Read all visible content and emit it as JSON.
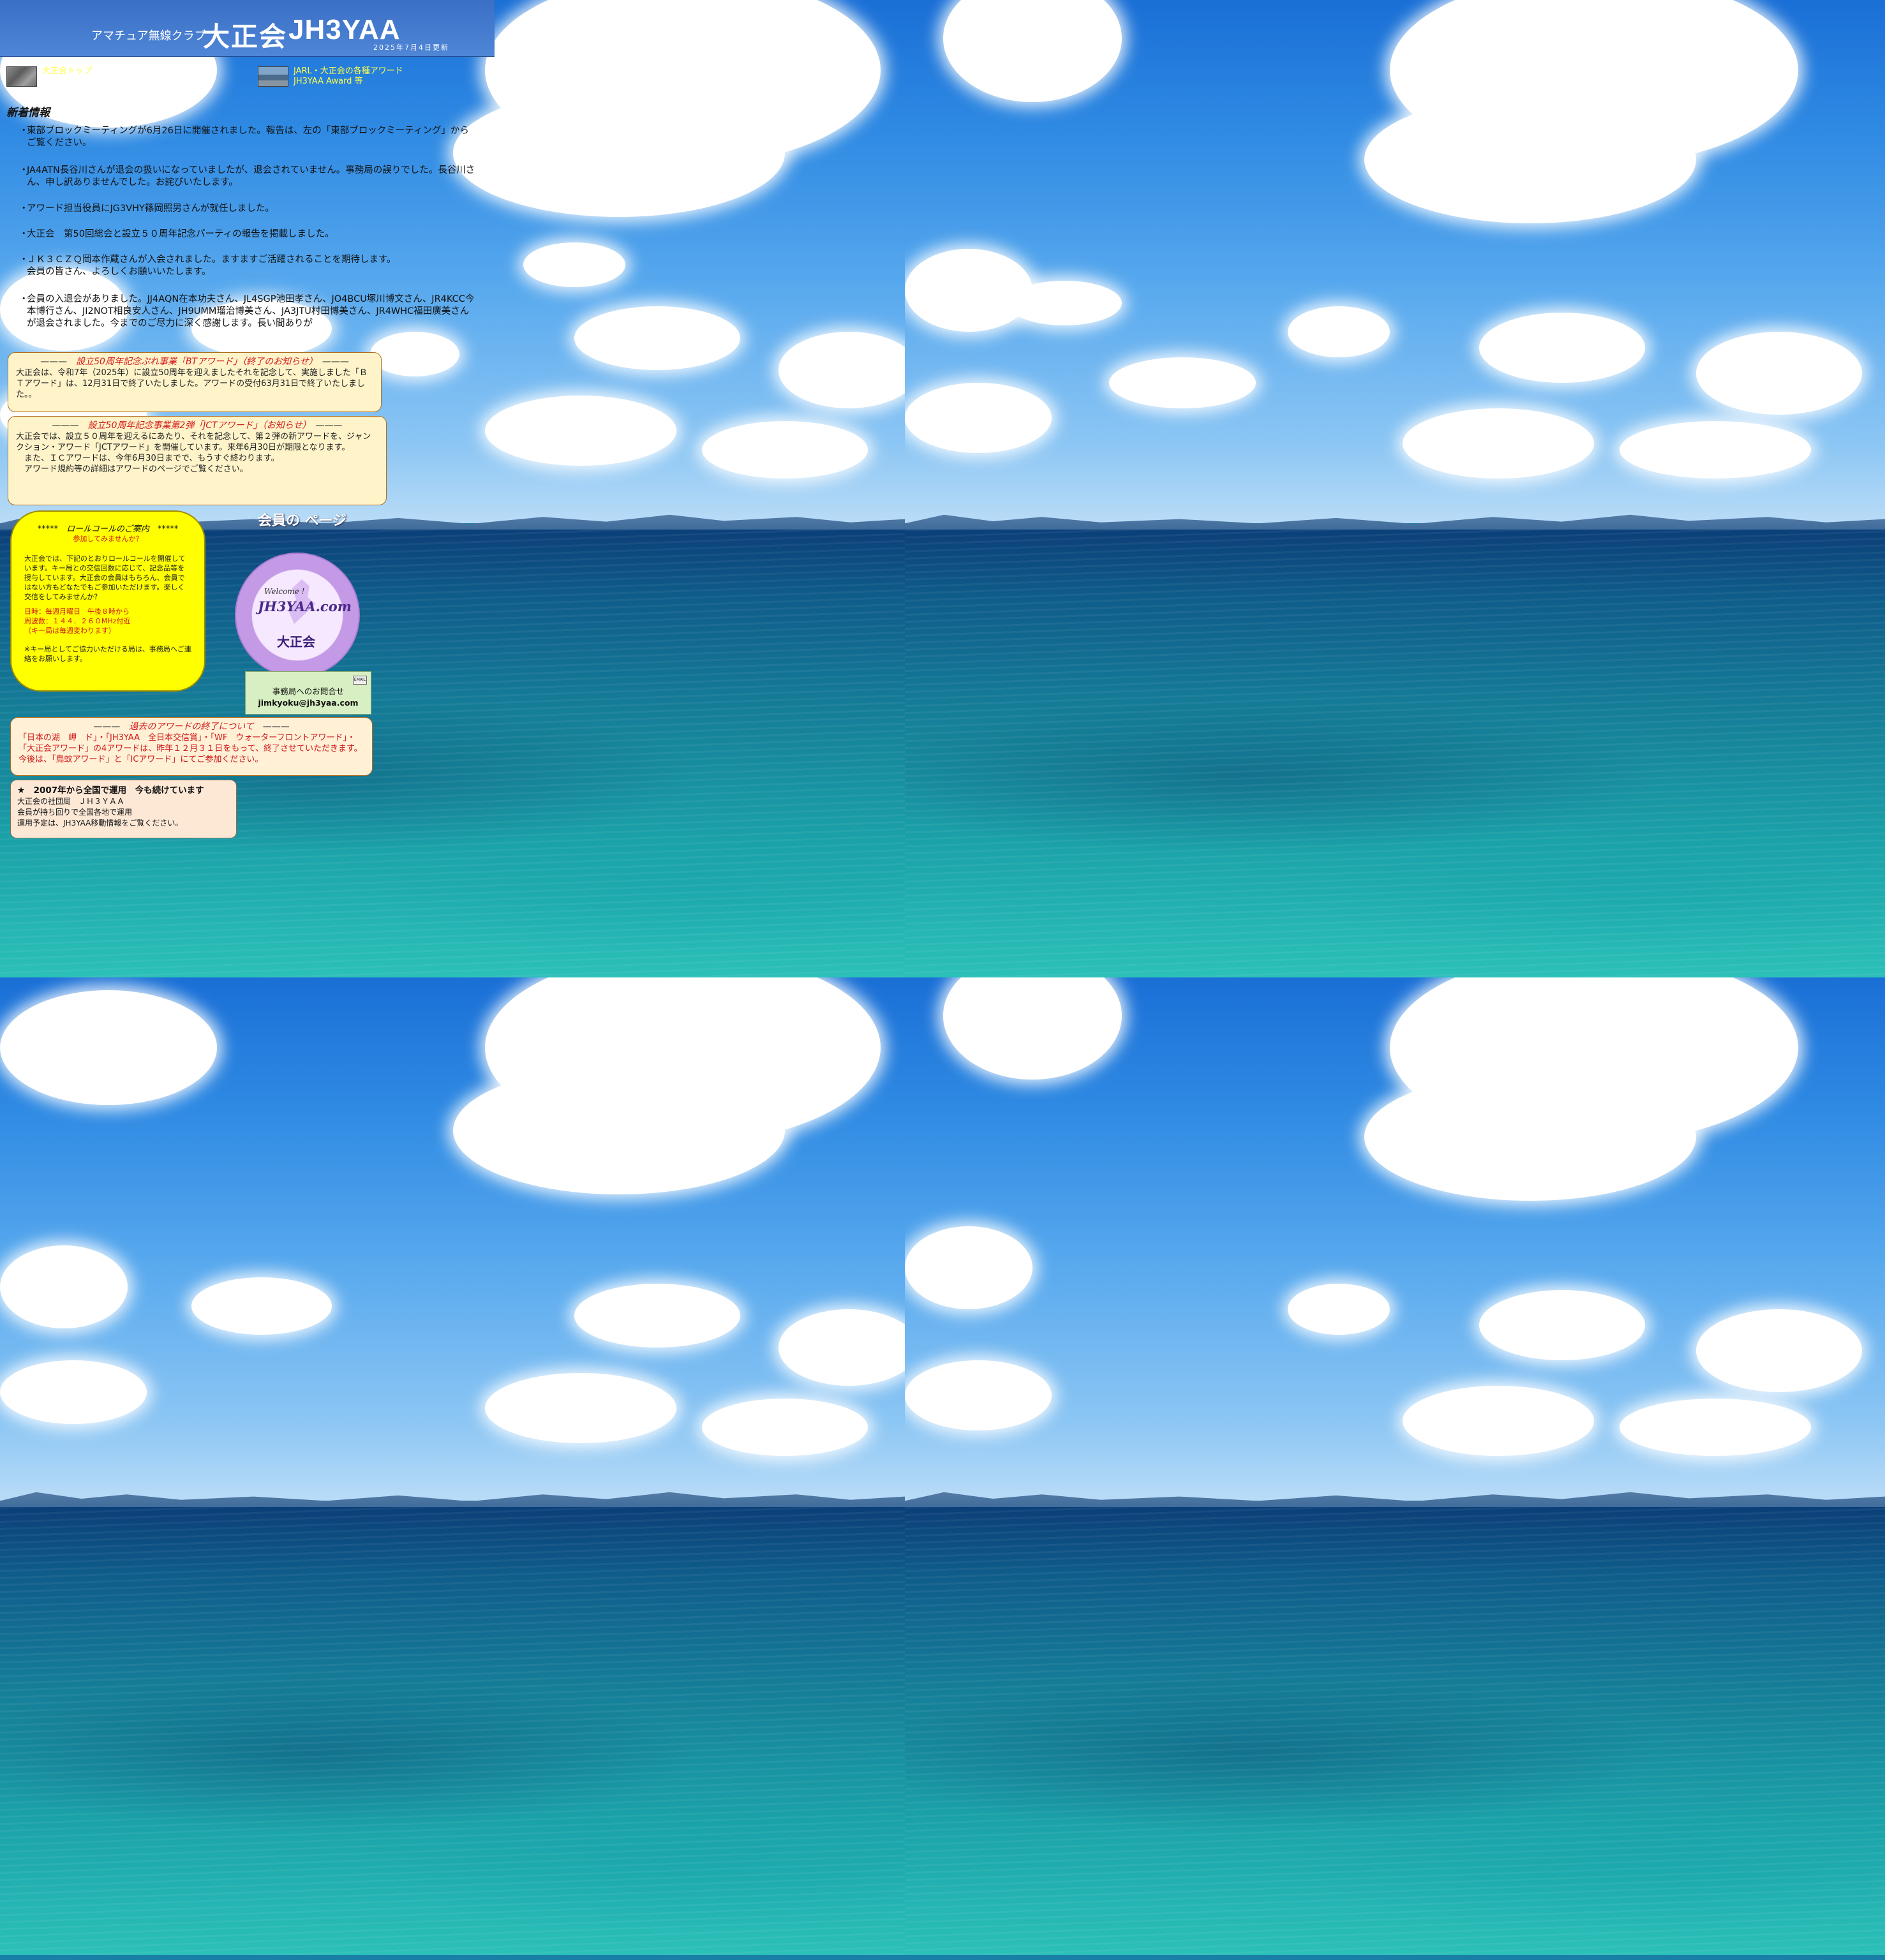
{
  "header": {
    "subtitle": "アマチュア無線クラブ",
    "club_name": "大正会",
    "callsign": "JH3YAA",
    "updated": "2025年7月4日更新"
  },
  "top_links": [
    {
      "label": "大正会トップ"
    },
    {
      "label": "JARL・大正会の各種アワード\nJH3YAA Award 等"
    }
  ],
  "news": {
    "title": "新着情報",
    "items": [
      "東部ブロックミーティングが6月26日に開催されました。報告は、左の「東部ブロックミーティング」からご覧ください。",
      "JA4ATN長谷川さんが退会の扱いになっていましたが、退会されていません。事務局の誤りでした。長谷川さん、申し訳ありませんでした。お詫びいたします。",
      "アワード担当役員にJG3VHY篠岡照男さんが就任しました。",
      "大正会　第50回総会と設立５０周年記念パーティの報告を掲載しました。",
      "ＪＫ３ＣＺＱ岡本作蔵さんが入会されました。ますますご活躍されることを期待します。\n会員の皆さん、よろしくお願いいたします。",
      "会員の入退会がありました。JJ4AQN在本功夫さん、JL4SGP池田孝さん、JO4BCU塚川博文さん、JR4KCC今本博行さん、JI2NOT相良安人さん、JH9UMM瑠治博美さん、JA3JTU村田博美さん、JR4WHC福田廣美さんが退会されました。今までのご尽力に深く感謝します。長い間ありが"
    ]
  },
  "bt_award": {
    "dash": "———",
    "title": "設立50周年記念ぷれ事業「BTアワード」（終了のお知らせ）",
    "body": "大正会は、令和7年（2025年）に設立50周年を迎えましたそれを記念して、実施しました「ＢＴアワード」は、12月31日で終了いたしました。アワードの受付63月31日で終了いたしました。。"
  },
  "jct_award": {
    "dash": "———",
    "title": "設立50周年記念事業第2弾「JCTアワード」（お知らせ）",
    "body": "大正会では、設立５０周年を迎えるにあたり、それを記念して、第２弾の新アワードを、ジャンクション・アワード「JCTアワード」を開催しています。来年6月30日が期限となります。\n　また、ＩＣアワードは、今年6月30日までで、もうすぐ終わります。\n　アワード規約等の詳細はアワードのページでご覧ください。"
  },
  "roll_call": {
    "title": "*****　ロールコールのご案内　*****",
    "subtitle": "参加してみませんか？",
    "body": "大正会では、下記のとおりロールコールを開催しています。キー局との交信回数に応じて、記念品等を授与しています。大正会の会員はもちろん、会員ではない方もどなたでもご参加いただけます。楽しく交信をしてみませんか？",
    "schedule": "日時：毎週月曜日　午後８時から\n周波数：１４４．２６０MHz付近\n（キー局は毎週変わります）",
    "note": "※キー局としてご協力いただける局は、事務局へご連絡をお願いします。"
  },
  "members": {
    "title": "会員の ページ",
    "badge_welcome": "Welcome !",
    "badge_site": "JH3YAA.com",
    "badge_club": "大正会"
  },
  "contact": {
    "label": "事務局へのお問合せ",
    "email": "jimkyoku@jh3yaa.com",
    "icon_label": "EMAIL"
  },
  "past_awards": {
    "dash": "———",
    "title": "過去のアワードの終了について",
    "body": "「日本の湖　岬　ド」・「JH3YAA　全日本交信賞」・「WF　ウォーターフロントアワード」・「大正会アワード」の4アワードは、昨年１２月３１日をもって、終了させていただきます。今後は、「鳥蚊アワード」と「ICアワード」にてご参加ください。"
  },
  "operation": {
    "title": "★　2007年から全国で運用　今も続けています",
    "lines": [
      "大正会の社団局　ＪＨ３ＹＡＡ",
      "会員が持ち回りで全国各地で運用",
      "運用予定は、JH3YAA移動情報をご覧ください。"
    ]
  },
  "colors": {
    "header_bg": "#3a6fc6",
    "notice_title": "#d11a1a",
    "notice_bg": "#fff3c9",
    "roll_bg": "#ffff00",
    "link_text": "#ffff4a"
  }
}
